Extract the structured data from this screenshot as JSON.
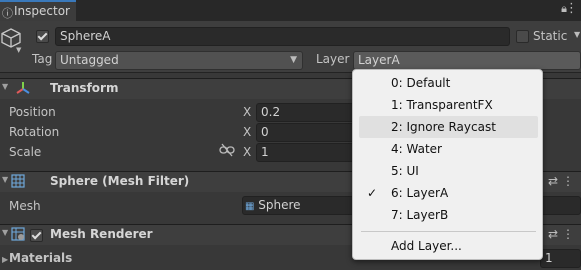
{
  "tab": {
    "label": "Inspector"
  },
  "object": {
    "name": "SphereA",
    "static_label": "Static",
    "tag_label": "Tag",
    "tag_value": "Untagged",
    "layer_label": "Layer",
    "layer_value": "LayerA"
  },
  "transform": {
    "title": "Transform",
    "rows": [
      {
        "label": "Position",
        "axis": "X",
        "value": "0.2"
      },
      {
        "label": "Rotation",
        "axis": "X",
        "value": "0"
      },
      {
        "label": "Scale",
        "axis": "X",
        "value": "1"
      }
    ]
  },
  "mesh_filter": {
    "title": "Sphere (Mesh Filter)",
    "mesh_label": "Mesh",
    "mesh_value": "Sphere"
  },
  "mesh_renderer": {
    "title": "Mesh Renderer",
    "materials_label": "Materials",
    "materials_count": "1"
  },
  "layer_menu": {
    "items": [
      {
        "label": "0: Default",
        "checked": false,
        "highlighted": false
      },
      {
        "label": "1: TransparentFX",
        "checked": false,
        "highlighted": false
      },
      {
        "label": "2: Ignore Raycast",
        "checked": false,
        "highlighted": true
      },
      {
        "label": "4: Water",
        "checked": false,
        "highlighted": false
      },
      {
        "label": "5: UI",
        "checked": false,
        "highlighted": false
      },
      {
        "label": "6: LayerA",
        "checked": true,
        "highlighted": false
      },
      {
        "label": "7: LayerB",
        "checked": false,
        "highlighted": false
      }
    ],
    "add_label": "Add Layer..."
  },
  "colors": {
    "accent": "#3a79bb",
    "panel": "#383838",
    "menu_bg": "#f0f0f0"
  }
}
